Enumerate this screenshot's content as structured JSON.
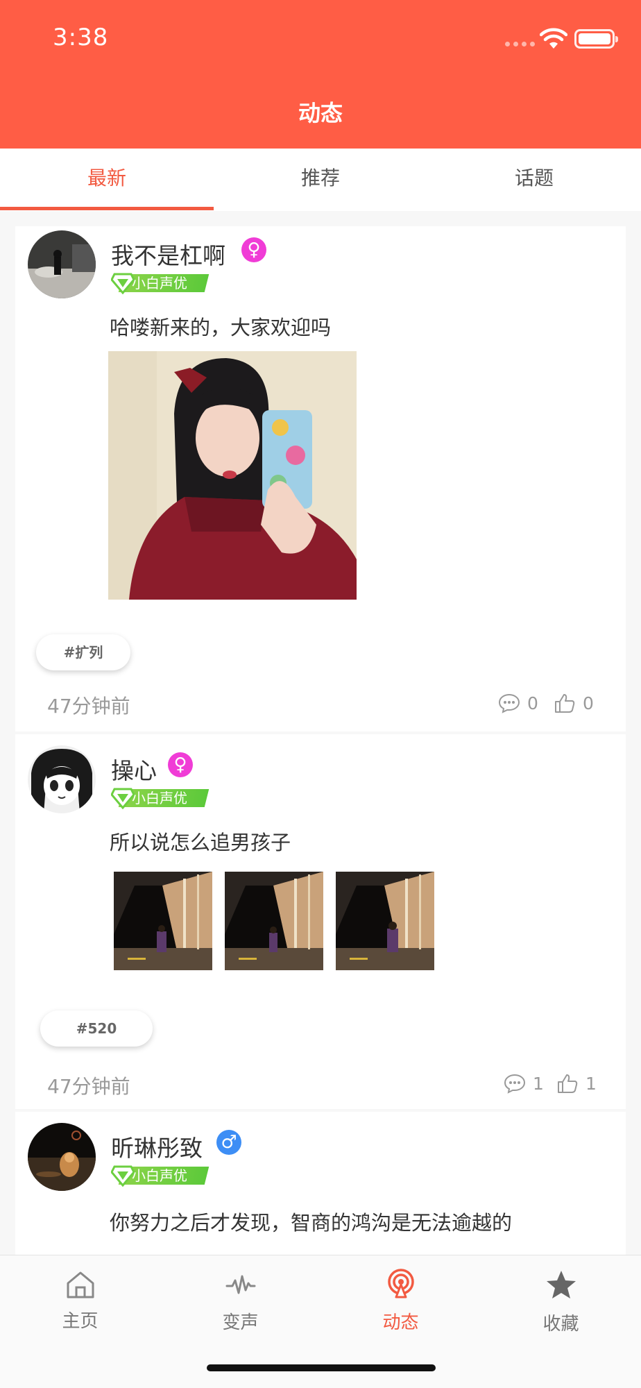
{
  "status_bar": {
    "time": "3:38"
  },
  "header": {
    "title": "动态"
  },
  "tabs": [
    {
      "label": "最新",
      "active": true
    },
    {
      "label": "推荐",
      "active": false
    },
    {
      "label": "话题",
      "active": false
    }
  ],
  "posts": [
    {
      "username": "我不是杠啊",
      "gender": "♀",
      "level": "小白声优",
      "text": "哈喽新来的，大家欢迎吗",
      "topic": "#扩列",
      "time": "47分钟前",
      "comments": "0",
      "likes": "0"
    },
    {
      "username": "操心",
      "gender": "♀",
      "level": "小白声优",
      "text": "所以说怎么追男孩子",
      "topic": "#520",
      "time": "47分钟前",
      "comments": "1",
      "likes": "1"
    },
    {
      "username": "昕琳彤致",
      "gender": "♂",
      "level": "小白声优",
      "text": "你努力之后才发现，智商的鸿沟是无法逾越的"
    }
  ],
  "bottom_nav": [
    {
      "label": "主页",
      "icon": "home-icon",
      "active": false
    },
    {
      "label": "变声",
      "icon": "waveform-icon",
      "active": false
    },
    {
      "label": "动态",
      "icon": "broadcast-icon",
      "active": true
    },
    {
      "label": "收藏",
      "icon": "star-icon",
      "active": false
    }
  ],
  "colors": {
    "accent": "#f25a41",
    "header": "#ff5d45",
    "female": "#f03cd6",
    "male": "#3d8ef5",
    "level": "#6ccf40"
  }
}
